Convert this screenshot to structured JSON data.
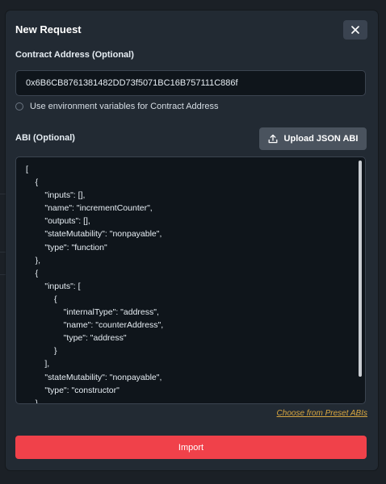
{
  "dialog": {
    "title": "New Request",
    "close_icon": "close-icon"
  },
  "contract": {
    "label": "Contract Address (Optional)",
    "value": "0x6B6CB8761381482DD73f5071BC16B757111C886f",
    "env_toggle_label": "Use environment variables for Contract Address",
    "env_toggle_checked": false
  },
  "abi": {
    "label": "ABI (Optional)",
    "upload_label": "Upload JSON ABI",
    "upload_icon": "upload-icon",
    "content": "[\n    {\n        \"inputs\": [],\n        \"name\": \"incrementCounter\",\n        \"outputs\": [],\n        \"stateMutability\": \"nonpayable\",\n        \"type\": \"function\"\n    },\n    {\n        \"inputs\": [\n            {\n                \"internalType\": \"address\",\n                \"name\": \"counterAddress\",\n                \"type\": \"address\"\n            }\n        ],\n        \"stateMutability\": \"nonpayable\",\n        \"type\": \"constructor\"\n    }\n]",
    "preset_link": "Choose from Preset ABIs"
  },
  "actions": {
    "import_label": "Import"
  },
  "colors": {
    "accent": "#f0414a",
    "link": "#d9a740",
    "panel": "#222a33",
    "field": "#0f151b"
  }
}
